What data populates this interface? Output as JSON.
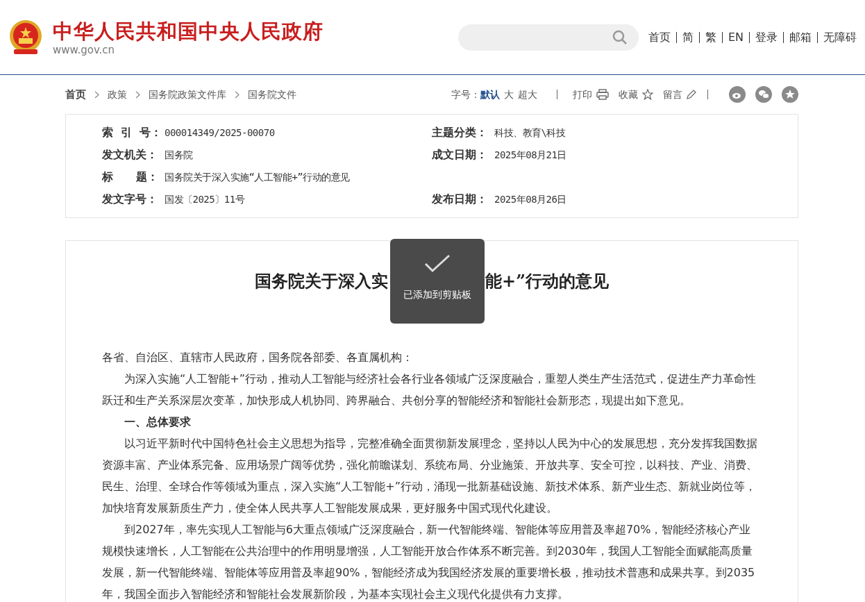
{
  "header": {
    "site_name": "中华人民共和国中央人民政府",
    "domain": "www.gov.cn",
    "nav": [
      "首页",
      "简",
      "繁",
      "EN",
      "登录",
      "邮箱",
      "无障碍"
    ]
  },
  "breadcrumb": [
    "首页",
    "政策",
    "国务院政策文件库",
    "国务院文件"
  ],
  "toolbar": {
    "font_size_label": "字号：",
    "font_sizes": [
      {
        "label": "默认",
        "selected": true
      },
      {
        "label": "大",
        "selected": false
      },
      {
        "label": "超大",
        "selected": false
      }
    ],
    "print": "打印",
    "favorite": "收藏",
    "comment": "留言"
  },
  "info_rows": [
    [
      {
        "label": "索  引  号：",
        "value": "000014349/2025-00070"
      },
      {
        "label": "主题分类：",
        "value": "科技、教育\\科技"
      }
    ],
    [
      {
        "label": "发文机关：",
        "value": "国务院"
      },
      {
        "label": "成文日期：",
        "value": "2025年08月21日"
      }
    ],
    [
      {
        "label": "标      题：",
        "value": "国务院关于深入实施“人工智能+”行动的意见"
      }
    ],
    [
      {
        "label": "发文字号：",
        "value": "国发〔2025〕11号"
      },
      {
        "label": "发布日期：",
        "value": "2025年08月26日"
      }
    ]
  ],
  "article": {
    "title_parts": [
      "国务院关于深入实",
      "能+”行动的意见"
    ],
    "paragraphs": [
      {
        "kind": "salutation",
        "text": "各省、自治区、直辖市人民政府，国务院各部委、各直属机构："
      },
      {
        "kind": "body",
        "text": "为深入实施“人工智能+”行动，推动人工智能与经济社会各行业各领域广泛深度融合，重塑人类生产生活范式，促进生产力革命性跃迁和生产关系深层次变革，加快形成人机协同、跨界融合、共创分享的智能经济和智能社会新形态，现提出如下意见。"
      },
      {
        "kind": "heading",
        "text": "一、总体要求"
      },
      {
        "kind": "body",
        "text": "以习近平新时代中国特色社会主义思想为指导，完整准确全面贯彻新发展理念，坚持以人民为中心的发展思想，充分发挥我国数据资源丰富、产业体系完备、应用场景广阔等优势，强化前瞻谋划、系统布局、分业施策、开放共享、安全可控，以科技、产业、消费、民生、治理、全球合作等领域为重点，深入实施“人工智能+”行动，涌现一批新基础设施、新技术体系、新产业生态、新就业岗位等，加快培育发展新质生产力，使全体人民共享人工智能发展成果，更好服务中国式现代化建设。"
      },
      {
        "kind": "body",
        "text": "到2027年，率先实现人工智能与6大重点领域广泛深度融合，新一代智能终端、智能体等应用普及率超70%，智能经济核心产业规模快速增长，人工智能在公共治理中的作用明显增强，人工智能开放合作体系不断完善。到2030年，我国人工智能全面赋能高质量发展，新一代智能终端、智能体等应用普及率超90%，智能经济成为我国经济发展的重要增长极，推动技术普惠和成果共享。到2035年，我国全面步入智能经济和智能社会发展新阶段，为基本实现社会主义现代化提供有力支撑。"
      }
    ]
  },
  "toast": {
    "message": "已添加到剪贴板"
  }
}
